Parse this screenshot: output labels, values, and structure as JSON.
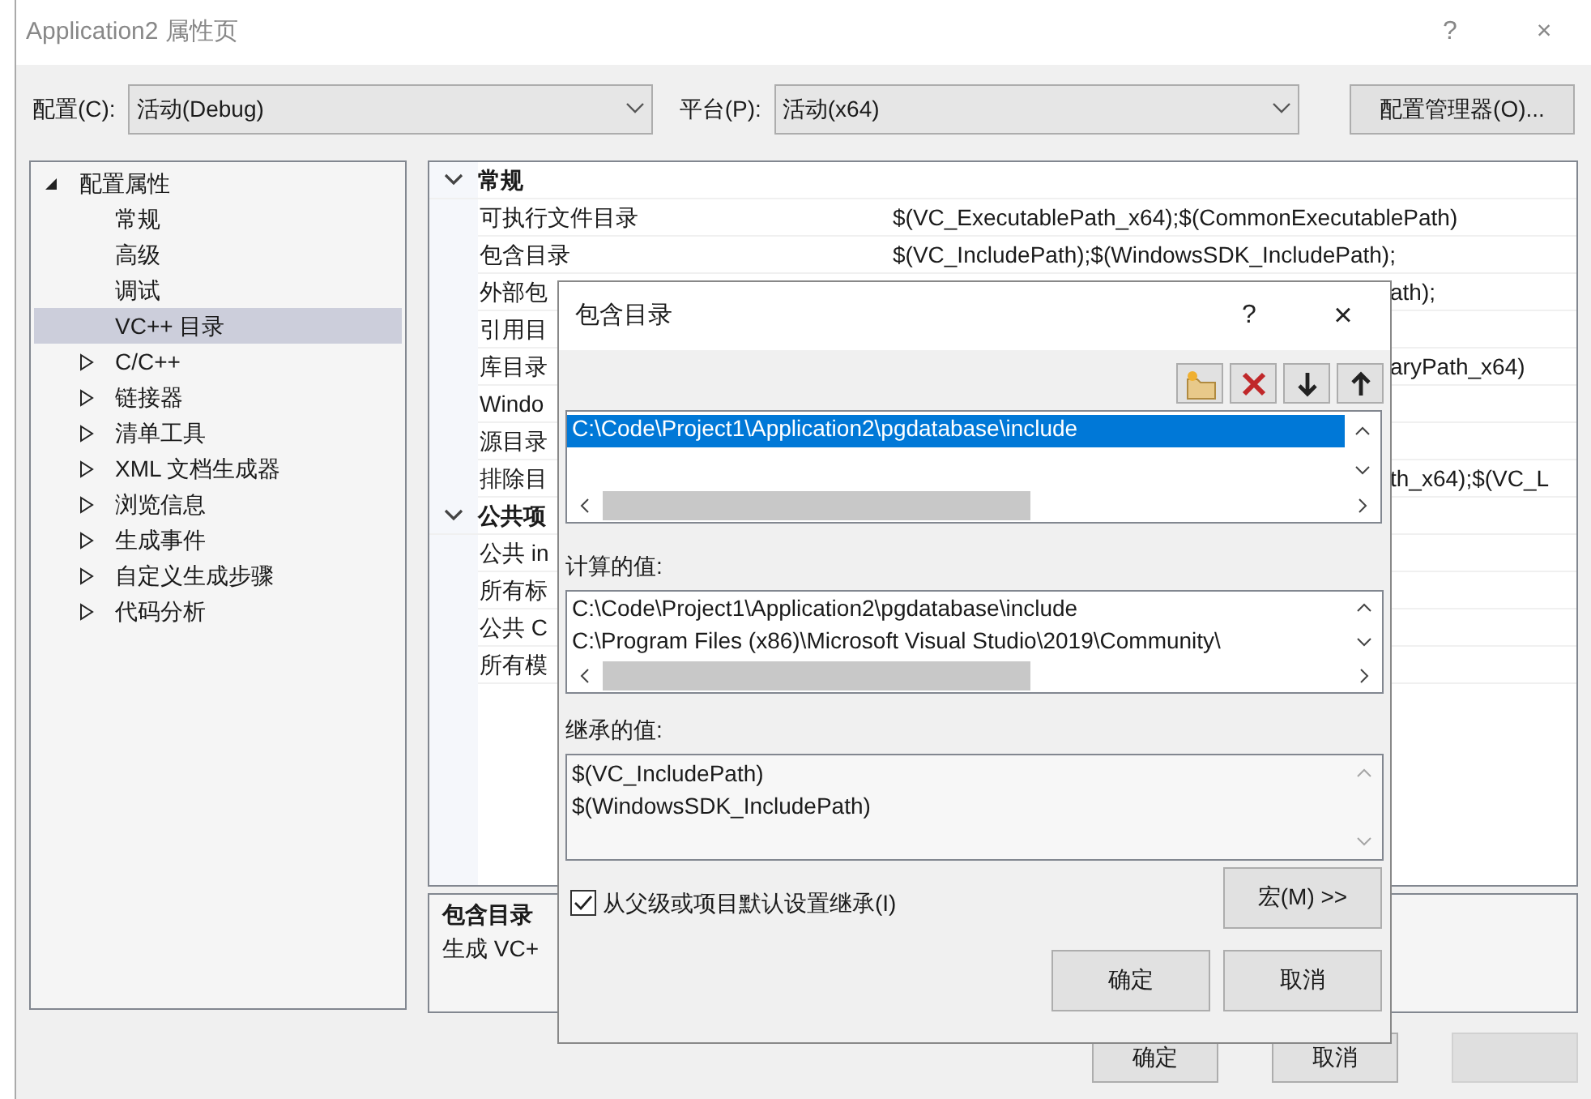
{
  "window": {
    "title": "Application2 属性页",
    "help": "?",
    "close": "×"
  },
  "config_bar": {
    "configuration_label": "配置(C):",
    "configuration_value": "活动(Debug)",
    "platform_label": "平台(P):",
    "platform_value": "活动(x64)",
    "manager_button": "配置管理器(O)..."
  },
  "tree": [
    {
      "label": "配置属性",
      "expanded": true,
      "selected": false,
      "children": [
        {
          "label": "常规",
          "selected": false
        },
        {
          "label": "高级",
          "selected": false
        },
        {
          "label": "调试",
          "selected": false
        },
        {
          "label": "VC++ 目录",
          "selected": true
        },
        {
          "label": "C/C++",
          "expanded": false,
          "selected": false
        },
        {
          "label": "链接器",
          "expanded": false,
          "selected": false
        },
        {
          "label": "清单工具",
          "expanded": false,
          "selected": false
        },
        {
          "label": "XML 文档生成器",
          "expanded": false,
          "selected": false
        },
        {
          "label": "浏览信息",
          "expanded": false,
          "selected": false
        },
        {
          "label": "生成事件",
          "expanded": false,
          "selected": false
        },
        {
          "label": "自定义生成步骤",
          "expanded": false,
          "selected": false
        },
        {
          "label": "代码分析",
          "expanded": false,
          "selected": false
        }
      ]
    }
  ],
  "property_grid": {
    "groups": [
      {
        "label": "常规",
        "expanded": true,
        "rows": [
          {
            "name": "可执行文件目录",
            "value": "$(VC_ExecutablePath_x64);$(CommonExecutablePath)",
            "kind": "full"
          },
          {
            "name": "包含目录",
            "value": "$(VC_IncludePath);$(WindowsSDK_IncludePath);",
            "kind": "full"
          },
          {
            "name": "外部包",
            "value": "ath);",
            "kind": "covered"
          },
          {
            "name": "引用目"
          },
          {
            "name": "库目录",
            "value": "aryPath_x64)",
            "kind": "covered"
          },
          {
            "name": "Windo"
          },
          {
            "name": "源目录"
          },
          {
            "name": "排除目",
            "value": "th_x64);$(VC_L",
            "kind": "covered"
          }
        ]
      },
      {
        "label": "公共项",
        "expanded": true,
        "rows": [
          {
            "name": "公共 in"
          },
          {
            "name": "所有标"
          },
          {
            "name": "公共 C"
          },
          {
            "name": "所有模"
          }
        ]
      }
    ]
  },
  "description": {
    "title": "包含目录",
    "text": "生成 VC+"
  },
  "buttons": [
    {
      "label": "确定",
      "disabled": false
    },
    {
      "label": "取消",
      "disabled": false
    },
    {
      "disabled": true
    }
  ],
  "dialog": {
    "title": "包含目录",
    "help": "?",
    "close": "×",
    "entries": [
      {
        "text": "C:\\Code\\Project1\\Application2\\pgdatabase\\include",
        "selected": true
      }
    ],
    "evaluated_label": "计算的值:",
    "evaluated": [
      "C:\\Code\\Project1\\Application2\\pgdatabase\\include",
      "C:\\Program Files (x86)\\Microsoft Visual Studio\\2019\\Community\\"
    ],
    "inherited_label": "继承的值:",
    "inherited": [
      "$(VC_IncludePath)",
      "$(WindowsSDK_IncludePath)"
    ],
    "inherit_checkbox": {
      "label": "从父级或项目默认设置继承(I)",
      "checked": true
    },
    "macros_button": "宏(M) >>",
    "ok_button": "确定",
    "cancel_button": "取消"
  }
}
